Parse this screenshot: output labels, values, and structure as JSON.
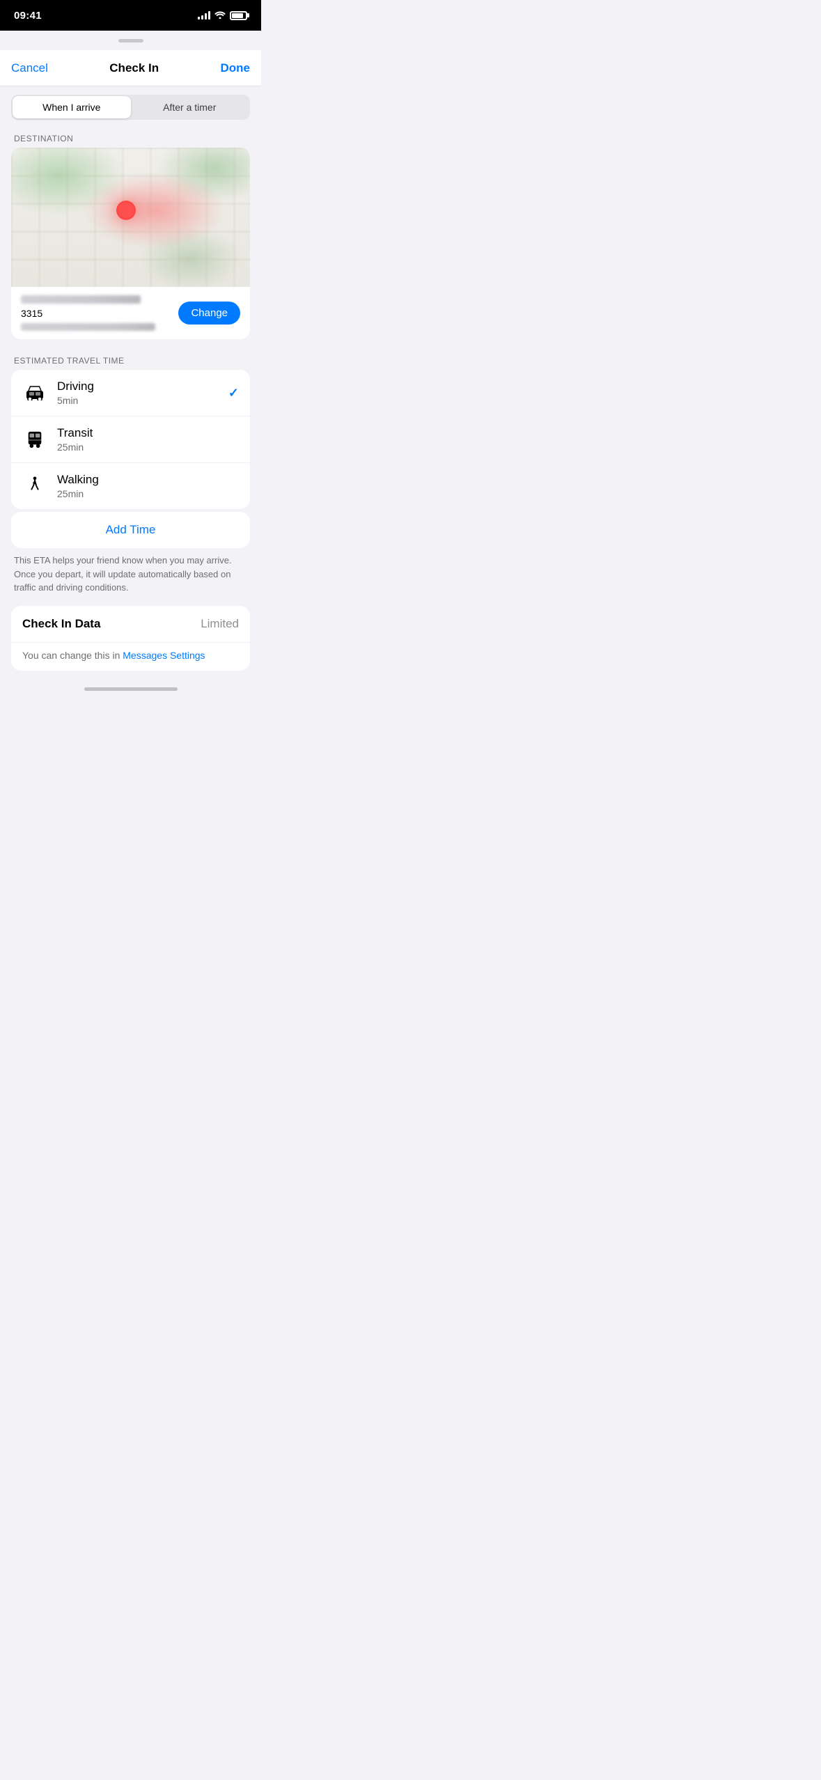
{
  "statusBar": {
    "time": "09:41",
    "batteryPercent": 85
  },
  "navBar": {
    "cancel": "Cancel",
    "title": "Check In",
    "done": "Done"
  },
  "segment": {
    "option1": "When I arrive",
    "option2": "After a timer",
    "activeIndex": 0
  },
  "destination": {
    "sectionLabel": "DESTINATION",
    "addressNumber": "3315",
    "changeButton": "Change"
  },
  "travelTime": {
    "sectionLabel": "ESTIMATED TRAVEL TIME",
    "modes": [
      {
        "name": "Driving",
        "duration": "5min",
        "selected": true
      },
      {
        "name": "Transit",
        "duration": "25min",
        "selected": false
      },
      {
        "name": "Walking",
        "duration": "25min",
        "selected": false
      }
    ],
    "addTime": "Add Time"
  },
  "description": "This ETA helps your friend know when you may arrive. Once you depart, it will update automatically based on traffic and driving conditions.",
  "checkInData": {
    "label": "Check In Data",
    "value": "Limited",
    "subText": "You can change this in ",
    "linkText": "Messages Settings"
  }
}
